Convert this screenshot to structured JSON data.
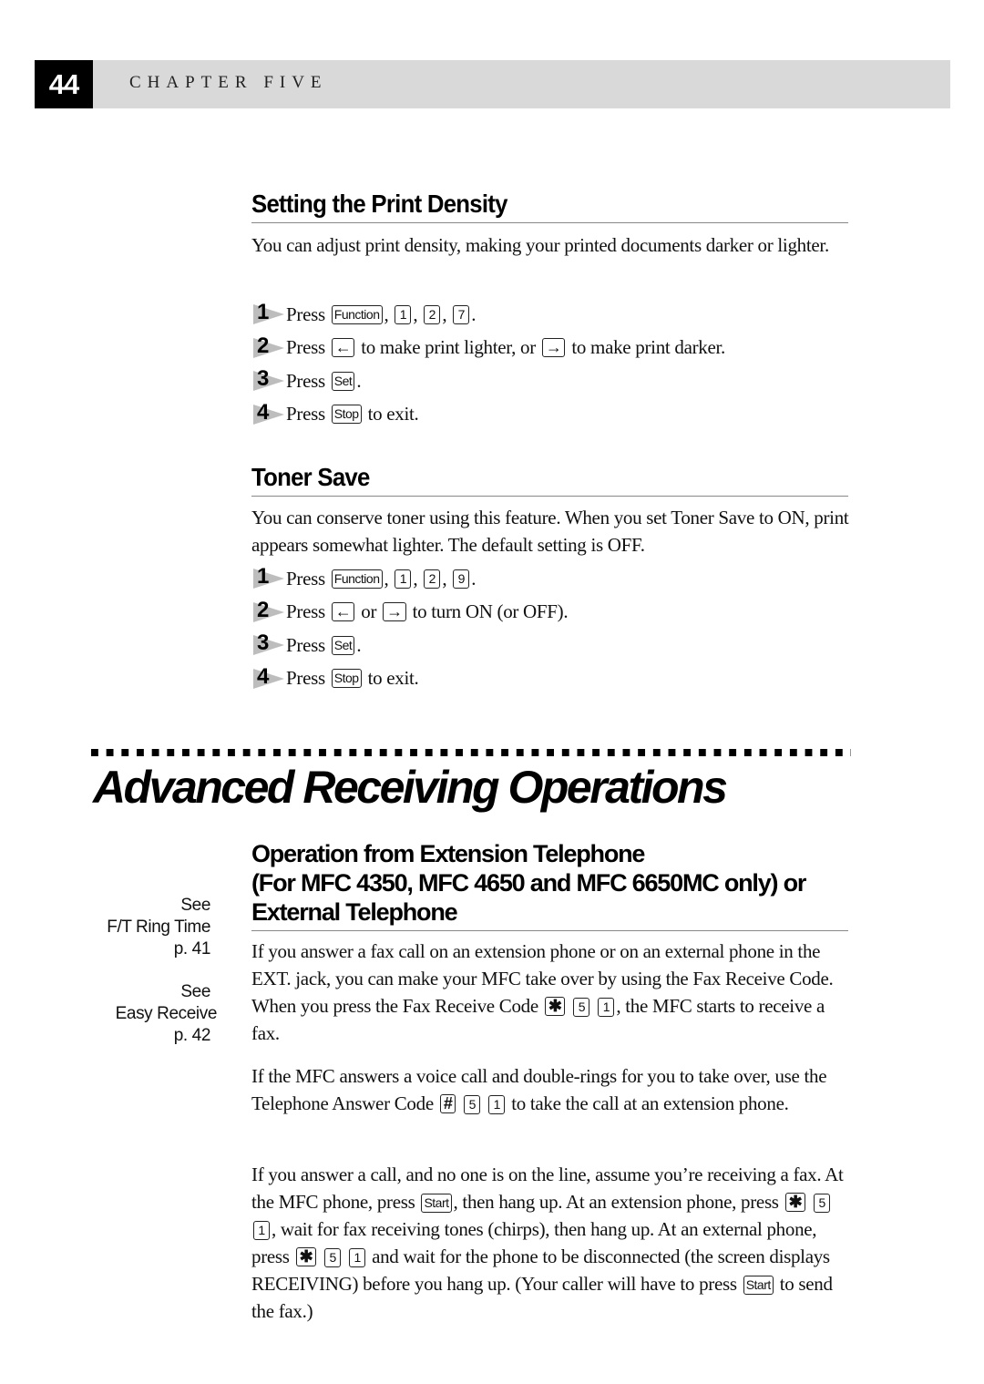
{
  "header": {
    "page_number": "44",
    "chapter": "CHAPTER FIVE"
  },
  "print_density": {
    "heading": "Setting the Print Density",
    "intro": "You can adjust print density, making your printed documents darker or lighter.",
    "steps": [
      {
        "num": "1",
        "pre": "Press",
        "keys": [
          "Function",
          "1",
          "2",
          "7"
        ],
        "post": "."
      },
      {
        "num": "2",
        "pre": "Press",
        "key_left": "←",
        "mid": "to make print lighter, or",
        "key_right": "→",
        "post": "to make print darker."
      },
      {
        "num": "3",
        "pre": "Press",
        "key": "Set",
        "post": "."
      },
      {
        "num": "4",
        "pre": "Press",
        "key": "Stop",
        "post": "to exit."
      }
    ]
  },
  "toner_save": {
    "heading": "Toner Save",
    "intro": "You can conserve toner using this feature.  When you set Toner Save to ON, print appears somewhat lighter.  The default setting is OFF.",
    "steps": [
      {
        "num": "1",
        "pre": "Press",
        "keys": [
          "Function",
          "1",
          "2",
          "9"
        ],
        "post": "."
      },
      {
        "num": "2",
        "pre": "Press",
        "key_left": "←",
        "mid": "or",
        "key_right": "→",
        "post": "to turn ON (or OFF)."
      },
      {
        "num": "3",
        "pre": "Press",
        "key": "Set",
        "post": "."
      },
      {
        "num": "4",
        "pre": "Press",
        "key": "Stop",
        "post": "to exit."
      }
    ]
  },
  "advanced": {
    "title": "Advanced Receiving Operations",
    "heading_lines": [
      "Operation from Extension Telephone",
      "(For MFC 4350, MFC 4650 and MFC 6650MC only) or",
      "External Telephone"
    ],
    "side_notes": [
      {
        "see": "See",
        "topic": "F/T Ring Time",
        "page": "p. 41"
      },
      {
        "see": "See",
        "topic": "Easy Receive",
        "page": "p. 42"
      }
    ],
    "p1": {
      "a": "If you answer a fax call on an extension phone or on an external phone in the EXT.  jack, you can make your MFC take over by using the Fax Receive Code. When you press the Fax Receive Code",
      "keys": [
        "✱",
        "5",
        "1"
      ],
      "b": ", the MFC starts to receive a fax."
    },
    "p2": {
      "a": "If the MFC answers a voice call and double-rings for you to take over, use the Telephone Answer Code",
      "keys": [
        "#",
        "5",
        "1"
      ],
      "b": "to take the call at an extension phone."
    },
    "p3": {
      "a": "If you answer a call, and no one is on the line, assume you’re receiving a fax. At the MFC phone, press",
      "key_start": "Start",
      "b": ", then hang up.  At an extension phone, press",
      "keys1": [
        "✱",
        "5",
        "1"
      ],
      "c": ", wait for fax receiving tones (chirps), then hang up.  At an external phone, press",
      "keys2": [
        "✱",
        "5",
        "1"
      ],
      "d": "and wait for the phone to be disconnected (the screen displays RECEIVING) before you hang up.  (Your caller will have to press",
      "key_start2": "Start",
      "e": "to send the fax.)"
    }
  }
}
